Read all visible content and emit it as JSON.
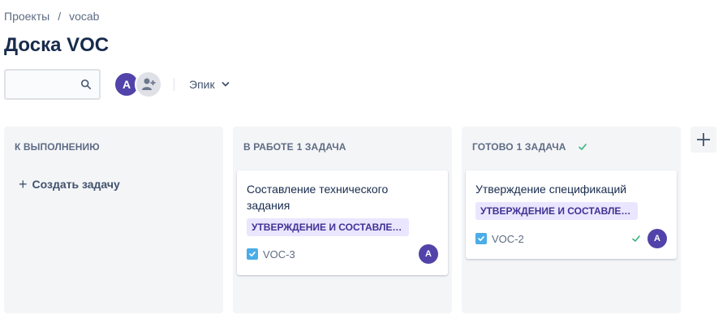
{
  "breadcrumb": {
    "items": [
      "Проекты",
      "vocab"
    ],
    "separator": "/"
  },
  "page": {
    "title": "Доска VOC"
  },
  "toolbar": {
    "search_value": "",
    "user_initial": "A",
    "epic_filter_label": "Эпик"
  },
  "columns": [
    {
      "title": "К ВЫПОЛНЕНИЮ",
      "count_label": "",
      "create_label": "Создать задачу"
    },
    {
      "title": "В РАБОТЕ",
      "count_label": "1 ЗАДАЧА"
    },
    {
      "title": "ГОТОВО",
      "count_label": "1 ЗАДАЧА"
    }
  ],
  "cards": [
    {
      "summary": "Составление технического задания",
      "epic": "УТВЕРЖДЕНИЕ И СОСТАВЛЕНИЕ ...",
      "key": "VOC-3",
      "assignee": "A"
    },
    {
      "summary": "Утверждение спецификаций",
      "epic": "УТВЕРЖДЕНИЕ И СОСТАВЛЕНИЕ ...",
      "key": "VOC-2",
      "assignee": "A"
    }
  ],
  "colors": {
    "accent": "#5243aa",
    "epic_bg": "#eae6ff",
    "epic_text": "#403294",
    "done": "#36b37e",
    "story": "#4bade8"
  },
  "icons": [
    "search-icon",
    "add-people-icon",
    "chevron-down-icon",
    "plus-icon",
    "check-icon",
    "story-icon"
  ]
}
